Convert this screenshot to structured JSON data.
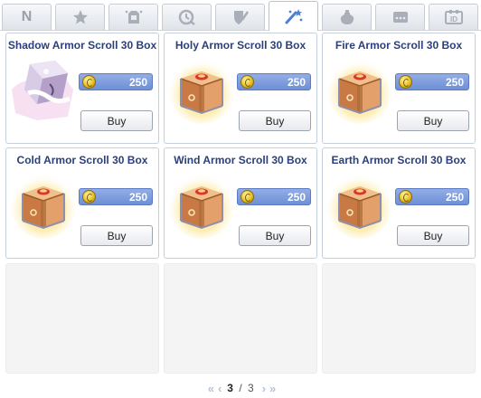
{
  "tabs": [
    {
      "label": "N",
      "icon": "new-icon"
    },
    {
      "label": "",
      "icon": "star-icon"
    },
    {
      "label": "",
      "icon": "costume-icon"
    },
    {
      "label": "",
      "icon": "timer-icon"
    },
    {
      "label": "",
      "icon": "shield-icon"
    },
    {
      "label": "",
      "icon": "scroll-icon"
    },
    {
      "label": "",
      "icon": "potion-icon"
    },
    {
      "label": "",
      "icon": "etc-icon"
    },
    {
      "label": "",
      "icon": "id-icon"
    }
  ],
  "active_tab": 5,
  "items": [
    {
      "name": "Shadow Armor Scroll 30 Box",
      "price": "250",
      "buy_label": "Buy",
      "image": "shadow-box-icon"
    },
    {
      "name": "Holy Armor Scroll 30 Box",
      "price": "250",
      "buy_label": "Buy",
      "image": "box-icon"
    },
    {
      "name": "Fire Armor Scroll 30 Box",
      "price": "250",
      "buy_label": "Buy",
      "image": "box-icon"
    },
    {
      "name": "Cold Armor Scroll 30 Box",
      "price": "250",
      "buy_label": "Buy",
      "image": "box-icon"
    },
    {
      "name": "Wind Armor Scroll 30 Box",
      "price": "250",
      "buy_label": "Buy",
      "image": "box-icon"
    },
    {
      "name": "Earth Armor Scroll 30 Box",
      "price": "250",
      "buy_label": "Buy",
      "image": "box-icon"
    }
  ],
  "pagination": {
    "current": "3",
    "separator": " / ",
    "total": "3"
  },
  "colors": {
    "title": "#2b3f7a",
    "price_bar": "#7b98dc",
    "coin": "#e8c020"
  }
}
